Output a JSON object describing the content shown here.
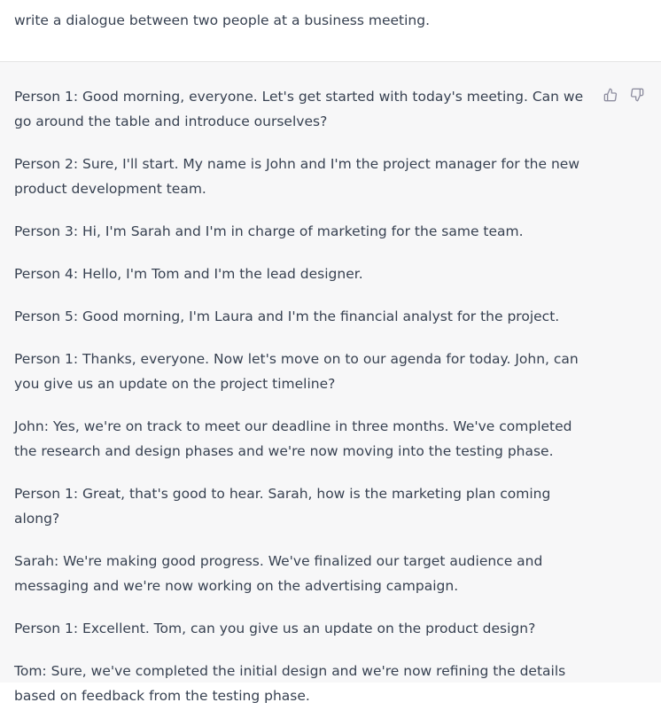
{
  "prompt": {
    "text": "write a dialogue between two people at a business meeting."
  },
  "response": {
    "paragraphs": [
      "Person 1: Good morning, everyone. Let's get started with today's meeting. Can we go around the table and introduce ourselves?",
      "Person 2: Sure, I'll start. My name is John and I'm the project manager for the new product development team.",
      "Person 3: Hi, I'm Sarah and I'm in charge of marketing for the same team.",
      "Person 4: Hello, I'm Tom and I'm the lead designer.",
      "Person 5: Good morning, I'm Laura and I'm the financial analyst for the project.",
      "Person 1: Thanks, everyone. Now let's move on to our agenda for today. John, can you give us an update on the project timeline?",
      "John: Yes, we're on track to meet our deadline in three months. We've completed the research and design phases and we're now moving into the testing phase.",
      "Person 1: Great, that's good to hear. Sarah, how is the marketing plan coming along?",
      "Sarah: We're making good progress. We've finalized our target audience and messaging and we're now working on the advertising campaign.",
      "Person 1: Excellent. Tom, can you give us an update on the product design?",
      "Tom: Sure, we've completed the initial design and we're now refining the details based on feedback from the testing phase."
    ]
  },
  "feedback": {
    "thumbs_up_icon": "thumbs-up-icon",
    "thumbs_down_icon": "thumbs-down-icon"
  },
  "colors": {
    "text": "#374151",
    "response_bg": "#f7f7f8",
    "divider": "#e5e5e5",
    "icon": "#8e8ea0"
  }
}
